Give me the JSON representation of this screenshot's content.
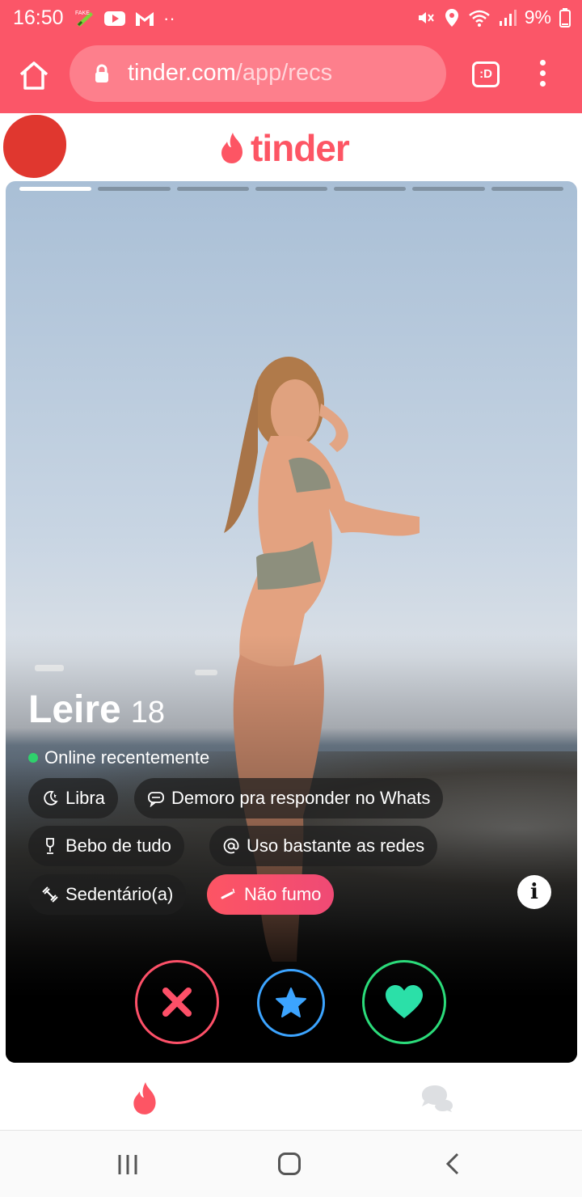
{
  "status_bar": {
    "time": "16:50",
    "battery": "9%",
    "icons": [
      "fake-gps-icon",
      "youtube-icon",
      "gmail-icon",
      "more-dots-icon",
      "mute-icon",
      "location-icon",
      "wifi-icon",
      "signal-icon",
      "battery-icon"
    ]
  },
  "browser": {
    "url_host": "tinder.com",
    "url_path": "/app/recs",
    "tabs_label": ":D",
    "icons": [
      "home-icon",
      "lock-icon",
      "menu-icon"
    ]
  },
  "header": {
    "logo_text": "tinder",
    "brand_color": "#fd5564"
  },
  "card": {
    "photo_count": 7,
    "active_photo": 1,
    "name": "Leire",
    "age": "18",
    "online_status": "Online recentemente",
    "chips": [
      {
        "label": "Libra",
        "icon": "moon-icon",
        "highlight": false
      },
      {
        "label": "Demoro pra responder no Whats",
        "icon": "chat-bubble-icon",
        "highlight": false
      },
      {
        "label": "Bebo de tudo",
        "icon": "wine-glass-icon",
        "highlight": false
      },
      {
        "label": "Uso bastante as redes",
        "icon": "at-sign-icon",
        "highlight": false
      },
      {
        "label": "Sedentário(a)",
        "icon": "dumbbell-icon",
        "highlight": false
      },
      {
        "label": "Não fumo",
        "icon": "smoking-icon",
        "highlight": true
      }
    ],
    "info_label": "i"
  },
  "actions": {
    "nope_color": "#fd5068",
    "super_like_color": "#3ca4ff",
    "like_color": "#2bdb7a"
  },
  "app_nav": {
    "items": [
      "flame-icon",
      "chat-icon"
    ],
    "active": "flame-icon"
  },
  "system_nav": {
    "items": [
      "recents-icon",
      "home-button-icon",
      "back-icon"
    ]
  }
}
